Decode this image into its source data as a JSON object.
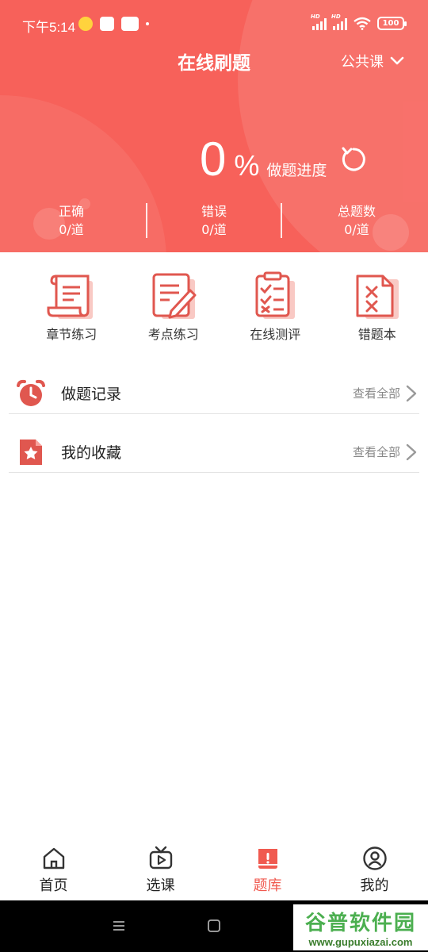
{
  "status_bar": {
    "time": "下午5:14",
    "app_icons": [
      "weibo-icon",
      "app-icon",
      "xiaohongshu-icon"
    ],
    "network_badges": [
      "HD",
      "HD"
    ],
    "battery": "100"
  },
  "header": {
    "title": "在线刷题",
    "category": "公共课",
    "progress_value": "0",
    "progress_unit": "%",
    "progress_label": "做题进度"
  },
  "stats": [
    {
      "label": "正确",
      "value": "0/道"
    },
    {
      "label": "错误",
      "value": "0/道"
    },
    {
      "label": "总题数",
      "value": "0/道"
    }
  ],
  "features": [
    {
      "label": "章节练习",
      "icon": "scroll-icon"
    },
    {
      "label": "考点练习",
      "icon": "edit-document-icon"
    },
    {
      "label": "在线测评",
      "icon": "checklist-icon"
    },
    {
      "label": "错题本",
      "icon": "wrong-answers-icon"
    }
  ],
  "rows": [
    {
      "label": "做题记录",
      "action": "查看全部",
      "icon": "alarm-clock-icon"
    },
    {
      "label": "我的收藏",
      "action": "查看全部",
      "icon": "star-file-icon"
    }
  ],
  "tabs": [
    {
      "label": "首页",
      "icon": "home-icon"
    },
    {
      "label": "选课",
      "icon": "tv-icon"
    },
    {
      "label": "题库",
      "icon": "question-bank-icon",
      "active": true
    },
    {
      "label": "我的",
      "icon": "user-icon"
    }
  ],
  "watermark": {
    "title": "谷普软件园",
    "url": "www.gupuxiazai.com"
  },
  "colors": {
    "accent": "#f7615a",
    "icon_red": "#e0574f",
    "icon_light": "#f9c9c4"
  }
}
